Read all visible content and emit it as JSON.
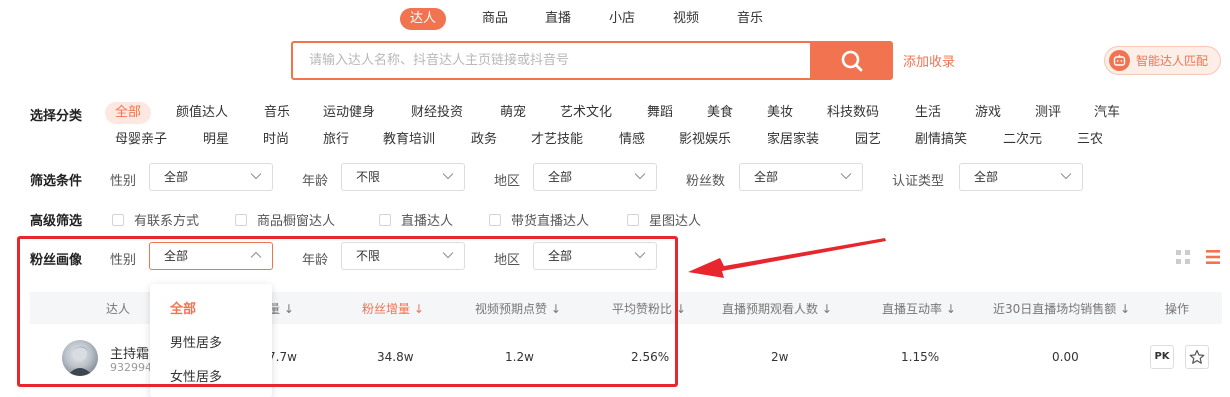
{
  "tabs": [
    "达人",
    "商品",
    "直播",
    "小店",
    "视频",
    "音乐"
  ],
  "search": {
    "placeholder": "请输入达人名称、抖音达人主页链接或抖音号",
    "add_label": "添加收录",
    "smart_label": "智能达人匹配"
  },
  "categories": {
    "label": "选择分类",
    "row1": [
      "全部",
      "颜值达人",
      "音乐",
      "运动健身",
      "财经投资",
      "萌宠",
      "艺术文化",
      "舞蹈",
      "美食",
      "美妆",
      "科技数码",
      "生活",
      "游戏",
      "测评",
      "汽车"
    ],
    "row2": [
      "母婴亲子",
      "明星",
      "时尚",
      "旅行",
      "教育培训",
      "政务",
      "才艺技能",
      "情感",
      "影视娱乐",
      "家居家装",
      "园艺",
      "剧情搞笑",
      "二次元",
      "三农"
    ]
  },
  "filters": {
    "label": "筛选条件",
    "gender_label": "性别",
    "gender_value": "全部",
    "age_label": "年龄",
    "age_value": "不限",
    "region_label": "地区",
    "region_value": "全部",
    "fans_label": "粉丝数",
    "fans_value": "全部",
    "cert_label": "认证类型",
    "cert_value": "全部"
  },
  "advanced": {
    "label": "高级筛选",
    "options": [
      "有联系方式",
      "商品橱窗达人",
      "直播达人",
      "带货直播达人",
      "星图达人"
    ]
  },
  "fan_profile": {
    "label": "粉丝画像",
    "gender_label": "性别",
    "gender_value": "全部",
    "age_label": "年龄",
    "age_value": "不限",
    "region_label": "地区",
    "region_value": "全部"
  },
  "dropdown": {
    "options": [
      "全部",
      "男性居多",
      "女性居多"
    ]
  },
  "table": {
    "headers": {
      "influencer": "达人",
      "total": "总量",
      "fan_growth": "粉丝增量",
      "video_likes": "视频预期点赞",
      "avg_like_ratio": "平均赞粉比",
      "live_viewers": "直播预期观看人数",
      "live_interaction": "直播互动率",
      "live_sales": "近30日直播场均销售额",
      "actions": "操作"
    },
    "row": {
      "name": "主持霜",
      "id": "932994",
      "total": "7.7w",
      "fan_growth": "34.8w",
      "video_likes": "1.2w",
      "avg_like_ratio": "2.56%",
      "live_viewers": "2w",
      "live_interaction": "1.15%",
      "live_sales": "0.00",
      "pk_label": "PK"
    }
  },
  "colors": {
    "accent": "#f27350",
    "highlight_frame": "#e8262e"
  }
}
